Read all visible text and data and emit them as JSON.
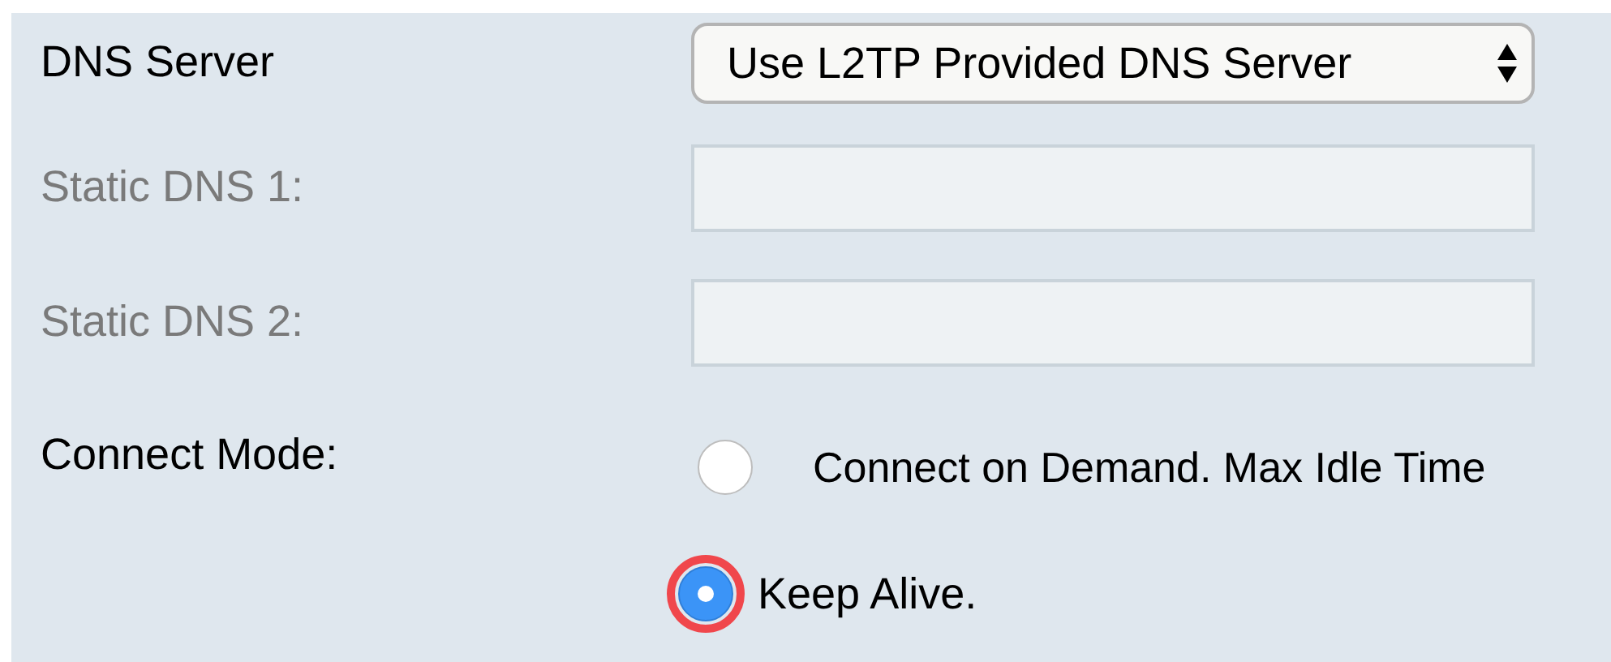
{
  "dns_server": {
    "label": "DNS Server",
    "value": "Use L2TP Provided DNS Server"
  },
  "static_dns": [
    {
      "label": "Static DNS 1:",
      "disabled": true
    },
    {
      "label": "Static DNS 2:",
      "disabled": true
    }
  ],
  "connect_mode": {
    "label": "Connect Mode:",
    "options": [
      {
        "label": "Connect on Demand. Max Idle Time",
        "selected": false,
        "highlighted": false
      },
      {
        "label": "Keep Alive.",
        "selected": true,
        "highlighted": true
      }
    ]
  }
}
